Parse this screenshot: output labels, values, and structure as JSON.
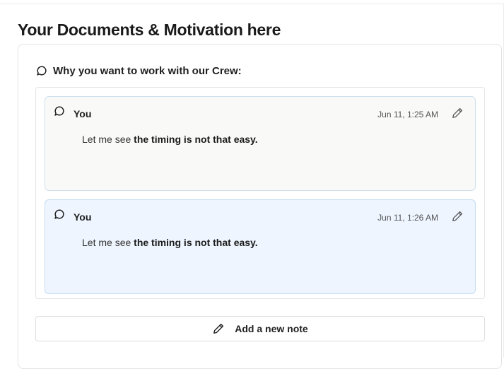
{
  "page": {
    "title": "Your Documents & Motivation here"
  },
  "section": {
    "heading": "Why you want to work with our Crew:",
    "heading_icon": "chat-bubble-icon"
  },
  "notes": [
    {
      "author": "You",
      "timestamp": "Jun 11, 1:25 AM",
      "text_plain": "Let me see ",
      "text_bold": "the timing is not that easy.",
      "icon": "chat-bubble-icon",
      "action_icon": "pencil-icon",
      "background": "#f9f9f7"
    },
    {
      "author": "You",
      "timestamp": "Jun 11, 1:26 AM",
      "text_plain": "Let me see ",
      "text_bold": "the timing is not that easy.",
      "icon": "chat-bubble-icon",
      "action_icon": "pencil-icon",
      "background": "#eef5ff"
    }
  ],
  "add_note": {
    "label": "Add a new note",
    "icon": "pencil-icon"
  }
}
